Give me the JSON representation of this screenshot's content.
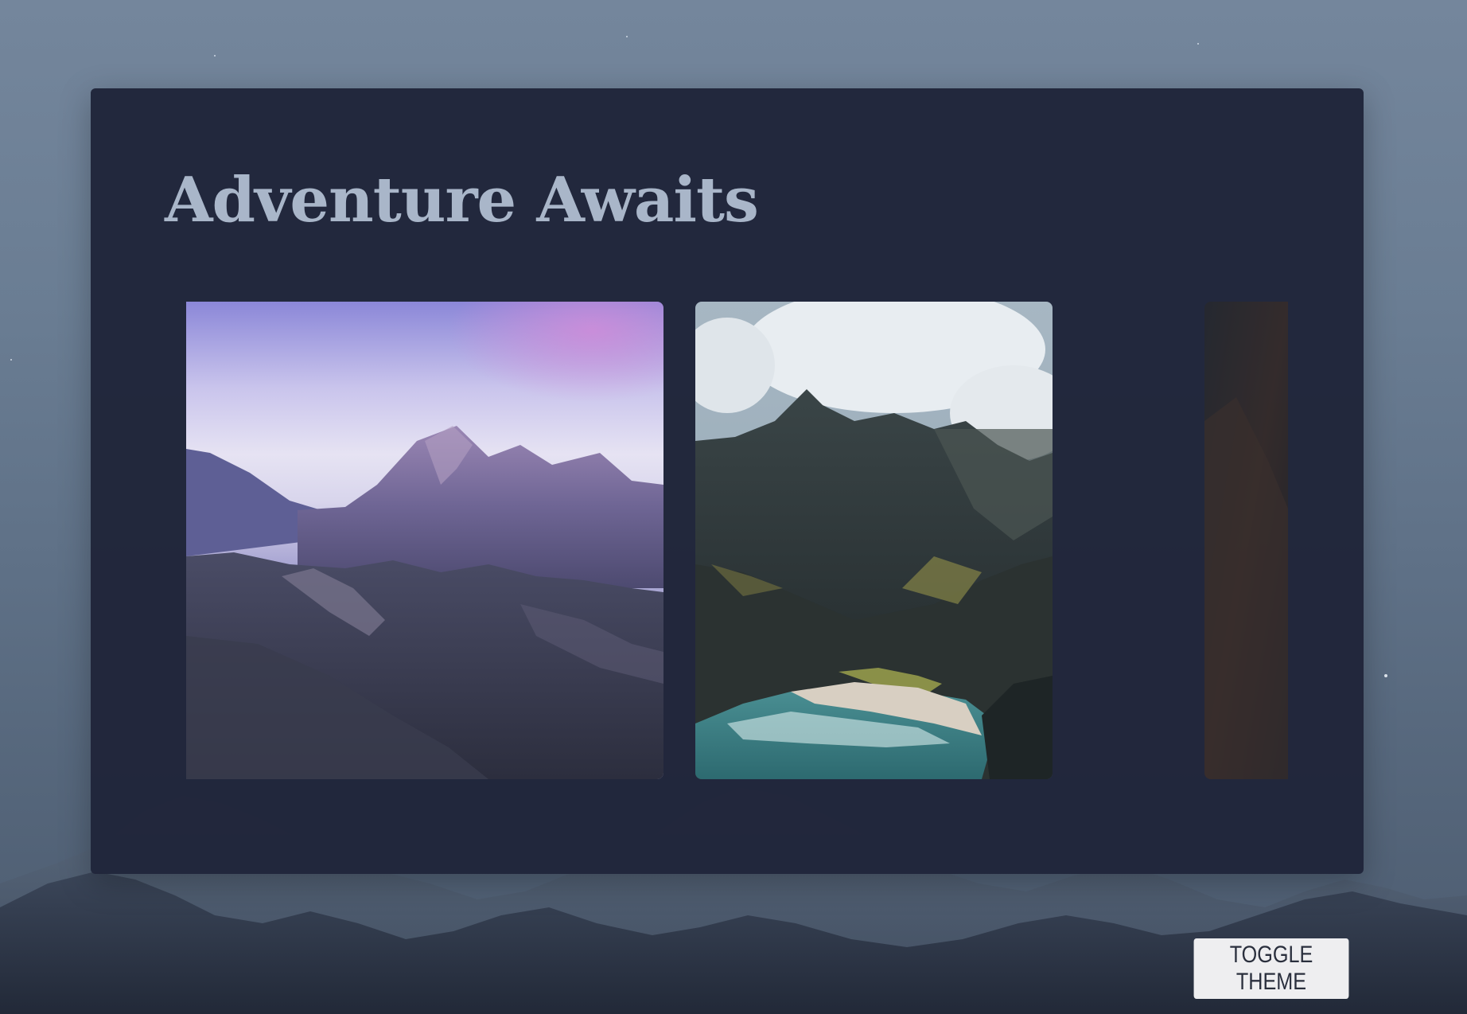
{
  "page": {
    "title": "Adventure Awaits"
  },
  "gallery": {
    "photos": [
      {
        "icon": "purple-mountain-peak-photo"
      },
      {
        "icon": "coastal-cliffs-beach-photo"
      },
      {
        "icon": "dark-partial-photo"
      }
    ]
  },
  "controls": {
    "toggle_theme_label": "TOGGLE THEME"
  },
  "colors": {
    "card_background": "#20253a",
    "title_text": "#a9b6c9",
    "button_background": "#eeeef0",
    "button_text": "#2a2f3d"
  }
}
